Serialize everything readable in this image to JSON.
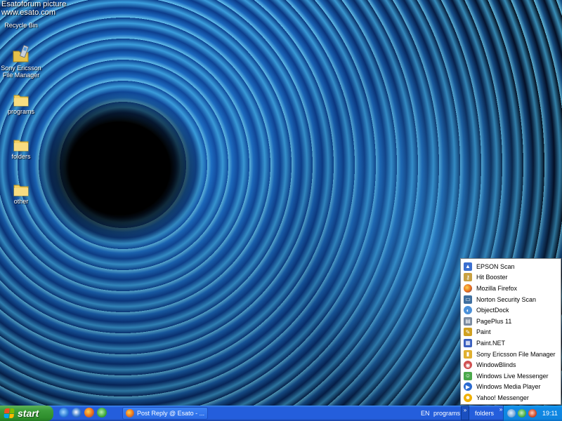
{
  "watermark": {
    "line1": "Esatoforum picture",
    "line2": "www.esato.com"
  },
  "desktop_icons": [
    {
      "label": "Recycle Bin",
      "icon": "recycle-bin-icon"
    },
    {
      "label": "Sony Ericsson File Manager",
      "icon": "phone-icon"
    },
    {
      "label": "programs",
      "icon": "folder-icon"
    },
    {
      "label": "folders",
      "icon": "folder-icon"
    },
    {
      "label": "other",
      "icon": "folder-icon"
    }
  ],
  "menu": {
    "items": [
      {
        "label": "EPSON Scan",
        "icon": "epson-scan-icon",
        "color": "#3a6fd0"
      },
      {
        "label": "Hit Booster",
        "icon": "key-icon",
        "color": "#c8a040"
      },
      {
        "label": "Mozilla Firefox",
        "icon": "firefox-icon",
        "color": "#e86a1a"
      },
      {
        "label": "Norton Security Scan",
        "icon": "norton-icon",
        "color": "#3f6f9f"
      },
      {
        "label": "ObjectDock",
        "icon": "objectdock-icon",
        "color": "#4a90d9"
      },
      {
        "label": "PagePlus 11",
        "icon": "pageplus-icon",
        "color": "#7a8aa0"
      },
      {
        "label": "Paint",
        "icon": "paint-icon",
        "color": "#d0a020"
      },
      {
        "label": "Paint.NET",
        "icon": "paintnet-icon",
        "color": "#3a5fbf"
      },
      {
        "label": "Sony Ericsson File Manager",
        "icon": "sony-ericsson-icon",
        "color": "#e0b030"
      },
      {
        "label": "WindowBlinds",
        "icon": "windowblinds-icon",
        "color": "#d05050"
      },
      {
        "label": "Windows Live Messenger",
        "icon": "messenger-icon",
        "color": "#4aa84a"
      },
      {
        "label": "Windows Media Player",
        "icon": "media-player-icon",
        "color": "#2a6ad0"
      },
      {
        "label": "Yahoo! Messenger",
        "icon": "yahoo-icon",
        "color": "#f0b000"
      }
    ]
  },
  "taskbar": {
    "start_label": "start",
    "task_button_label": "Post Reply @ Esato - ...",
    "language": "EN",
    "toolbar_programs": "programs",
    "toolbar_folders": "folders",
    "chevron": "»",
    "clock": "19:11"
  },
  "colors": {
    "taskbar_blue": "#245edc",
    "start_green": "#3c9d3a",
    "tray_blue": "#0f8ae6"
  }
}
